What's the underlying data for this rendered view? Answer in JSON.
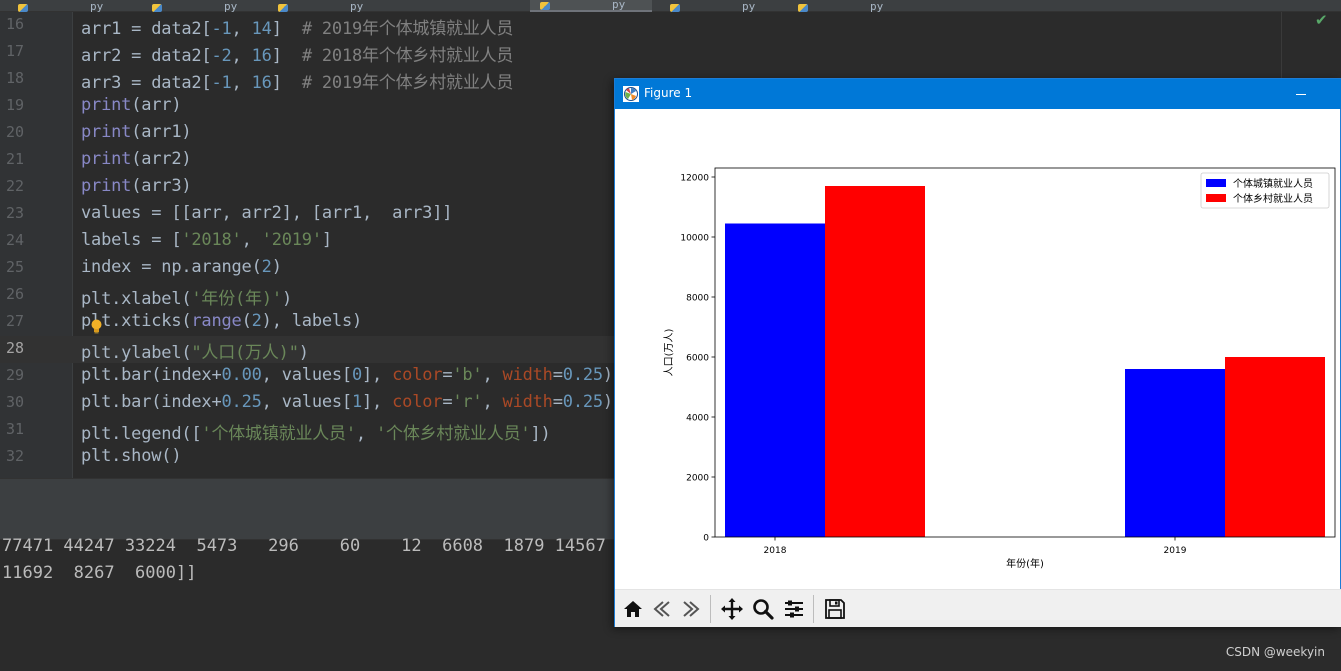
{
  "editor": {
    "tabs": [
      {
        "label": "py",
        "active": false
      },
      {
        "label": "py",
        "active": false
      },
      {
        "label": "py",
        "active": false
      },
      {
        "label": "py",
        "active": true
      },
      {
        "label": "py",
        "active": false
      },
      {
        "label": "py",
        "active": false
      }
    ],
    "current_line": 28,
    "lines": [
      {
        "no": "16",
        "tokens": [
          [
            "",
            "arr1 = data2["
          ],
          [
            "t-num",
            "-1"
          ],
          [
            "",
            ", "
          ],
          [
            "t-num",
            "14"
          ],
          [
            "",
            "]  "
          ],
          [
            "t-cm",
            "# 2019年个体城镇就业人员"
          ]
        ]
      },
      {
        "no": "17",
        "tokens": [
          [
            "",
            "arr2 = data2["
          ],
          [
            "t-num",
            "-2"
          ],
          [
            "",
            ", "
          ],
          [
            "t-num",
            "16"
          ],
          [
            "",
            "]  "
          ],
          [
            "t-cm",
            "# 2018年个体乡村就业人员"
          ]
        ]
      },
      {
        "no": "18",
        "tokens": [
          [
            "",
            "arr3 = data2["
          ],
          [
            "t-num",
            "-1"
          ],
          [
            "",
            ", "
          ],
          [
            "t-num",
            "16"
          ],
          [
            "",
            "]  "
          ],
          [
            "t-cm",
            "# 2019年个体乡村就业人员"
          ]
        ]
      },
      {
        "no": "19",
        "tokens": [
          [
            "t-fn",
            "print"
          ],
          [
            "",
            "(arr)"
          ]
        ]
      },
      {
        "no": "20",
        "tokens": [
          [
            "t-fn",
            "print"
          ],
          [
            "",
            "(arr1)"
          ]
        ]
      },
      {
        "no": "21",
        "tokens": [
          [
            "t-fn",
            "print"
          ],
          [
            "",
            "(arr2)"
          ]
        ]
      },
      {
        "no": "22",
        "tokens": [
          [
            "t-fn",
            "print"
          ],
          [
            "",
            "(arr3)"
          ]
        ]
      },
      {
        "no": "23",
        "tokens": [
          [
            "",
            "values = [[arr, arr2], [arr1,  arr3]]"
          ]
        ]
      },
      {
        "no": "24",
        "tokens": [
          [
            "",
            "labels = ["
          ],
          [
            "t-str",
            "'2018'"
          ],
          [
            "",
            ", "
          ],
          [
            "t-str",
            "'2019'"
          ],
          [
            "",
            "]"
          ]
        ]
      },
      {
        "no": "25",
        "tokens": [
          [
            "",
            "index = np.arange("
          ],
          [
            "t-num",
            "2"
          ],
          [
            "",
            ")"
          ]
        ]
      },
      {
        "no": "26",
        "tokens": [
          [
            "",
            "plt.xlabel("
          ],
          [
            "t-str",
            "'年份(年)'"
          ],
          [
            "",
            ")"
          ]
        ]
      },
      {
        "no": "27",
        "tokens": [
          [
            "",
            "plt.xticks("
          ],
          [
            "t-fn",
            "range"
          ],
          [
            "",
            "("
          ],
          [
            "t-num",
            "2"
          ],
          [
            "",
            "), labels)"
          ]
        ]
      },
      {
        "no": "28",
        "tokens": [
          [
            "",
            "plt.ylabel("
          ],
          [
            "t-str",
            "\"人口(万人)\""
          ],
          [
            "",
            ")"
          ]
        ]
      },
      {
        "no": "29",
        "tokens": [
          [
            "",
            "plt.bar(index+"
          ],
          [
            "t-num",
            "0.00"
          ],
          [
            "",
            ", values["
          ],
          [
            "t-num",
            "0"
          ],
          [
            "",
            "], "
          ],
          [
            "t-param",
            "color"
          ],
          [
            "",
            "="
          ],
          [
            "t-str",
            "'b'"
          ],
          [
            "",
            ", "
          ],
          [
            "t-param",
            "width"
          ],
          [
            "",
            "="
          ],
          [
            "t-num",
            "0.25"
          ],
          [
            "",
            ")"
          ]
        ]
      },
      {
        "no": "30",
        "tokens": [
          [
            "",
            "plt.bar(index+"
          ],
          [
            "t-num",
            "0.25"
          ],
          [
            "",
            ", values["
          ],
          [
            "t-num",
            "1"
          ],
          [
            "",
            "], "
          ],
          [
            "t-param",
            "color"
          ],
          [
            "",
            "="
          ],
          [
            "t-str",
            "'r'"
          ],
          [
            "",
            ", "
          ],
          [
            "t-param",
            "width"
          ],
          [
            "",
            "="
          ],
          [
            "t-num",
            "0.25"
          ],
          [
            "",
            ")"
          ]
        ]
      },
      {
        "no": "31",
        "tokens": [
          [
            "",
            "plt.legend(["
          ],
          [
            "t-str",
            "'个体城镇就业人员'"
          ],
          [
            "",
            ", "
          ],
          [
            "t-str",
            "'个体乡村就业人员'"
          ],
          [
            "",
            "])"
          ]
        ]
      },
      {
        "no": "32",
        "tokens": [
          [
            "",
            "plt.show()"
          ]
        ]
      }
    ]
  },
  "console": {
    "lines": [
      "77471 44247 33224  5473   296    60    12  6608  1879 14567",
      "11692  8267  6000]]"
    ],
    "watermark": "CSDN @weekyin"
  },
  "figure": {
    "title": "Figure 1",
    "toolbar": [
      {
        "name": "home-icon"
      },
      {
        "name": "back-icon"
      },
      {
        "name": "forward-icon"
      },
      {
        "name": "pan-icon"
      },
      {
        "name": "zoom-icon"
      },
      {
        "name": "configure-subplots-icon"
      },
      {
        "name": "save-icon"
      }
    ]
  },
  "chart_data": {
    "type": "bar",
    "categories": [
      "2018",
      "2019"
    ],
    "series": [
      {
        "name": "个体城镇就业人员",
        "values": [
          10450,
          5600
        ],
        "color": "#0000ff"
      },
      {
        "name": "个体乡村就业人员",
        "values": [
          11700,
          6000
        ],
        "color": "#ff0000"
      }
    ],
    "xlabel": "年份(年)",
    "ylabel": "人口(万人)",
    "ylim": [
      0,
      12300
    ],
    "xlim": [
      -0.15,
      1.4
    ],
    "bar_width": 0.25,
    "yticks": [
      0,
      2000,
      4000,
      6000,
      8000,
      10000,
      12000
    ],
    "legend_loc": "top-right",
    "grid": false
  }
}
